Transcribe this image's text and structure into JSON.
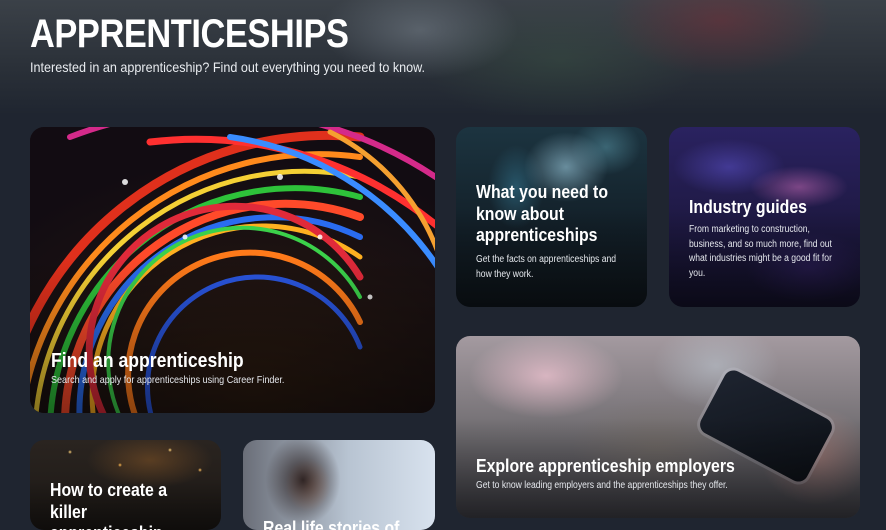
{
  "hero": {
    "title": "APPRENTICESHIPS",
    "subtitle": "Interested in an apprenticeship? Find out everything you need to know."
  },
  "cards": {
    "find": {
      "title": "Find an apprenticeship",
      "description": "Search and apply for apprenticeships using Career Finder."
    },
    "need": {
      "title": "What you need to know about apprenticeships",
      "description": "Get the facts on apprenticeships and how they work."
    },
    "industry": {
      "title": "Industry guides",
      "description": "From marketing to construction, business, and so much more, find out what industries might be a good fit for you."
    },
    "explore": {
      "title": "Explore apprenticeship employers",
      "description": "Get to know leading employers and the apprenticeships they offer."
    },
    "killer": {
      "title": "How to create a killer apprenticeship"
    },
    "life": {
      "title": "Real life stories of"
    }
  }
}
